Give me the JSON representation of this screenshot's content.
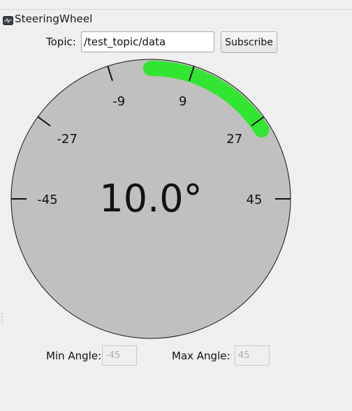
{
  "window": {
    "title": "SteeringWheel",
    "icon": "terminal-icon"
  },
  "topic": {
    "label": "Topic:",
    "value": "/test_topic/data",
    "subscribe_label": "Subscribe"
  },
  "gauge": {
    "angle_text": "10.0°",
    "value": 10.0,
    "min": -45,
    "max": 45,
    "tick_labels": [
      "-45",
      "-27",
      "-9",
      "9",
      "27",
      "45"
    ],
    "tick_values": [
      -45,
      -27,
      -9,
      9,
      27,
      45
    ],
    "indicator_color": "#33e533",
    "face_color": "#c0c0c0"
  },
  "limits": {
    "min_label": "Min Angle:",
    "min_value": "-45",
    "max_label": "Max Angle:",
    "max_value": "45"
  }
}
